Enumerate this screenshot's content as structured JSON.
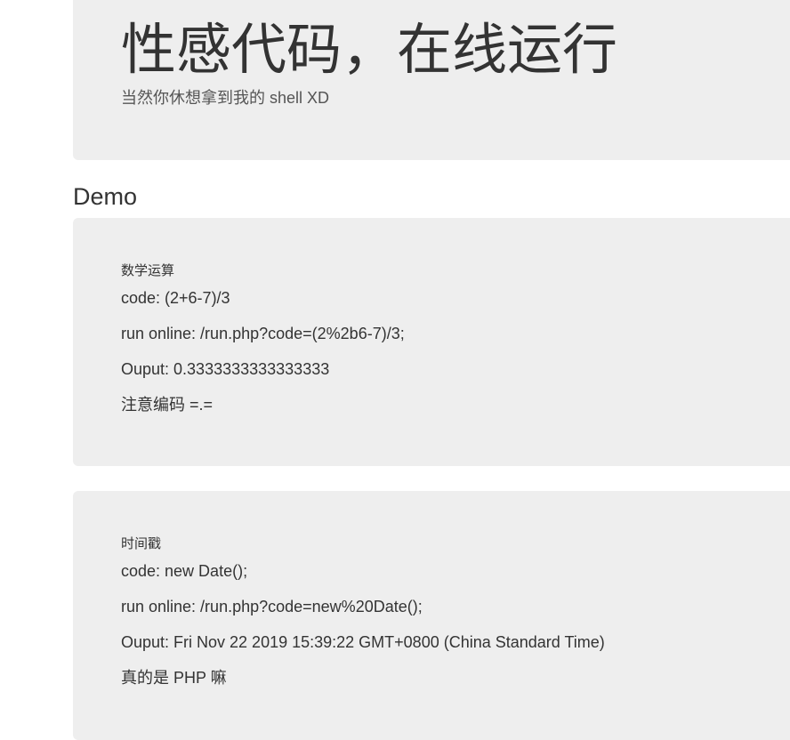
{
  "header": {
    "title": "性感代码，在线运行",
    "subtitle": "当然你休想拿到我的 shell XD"
  },
  "section": {
    "heading": "Demo"
  },
  "demos": [
    {
      "title": "数学运算",
      "code": "code: (2+6-7)/3",
      "run": "run online: /run.php?code=(2%2b6-7)/3;",
      "output": "Ouput: 0.3333333333333333",
      "note": "注意编码 =.="
    },
    {
      "title": "时间戳",
      "code": "code: new Date();",
      "run": "run online: /run.php?code=new%20Date();",
      "output": "Ouput: Fri Nov 22 2019 15:39:22 GMT+0800 (China Standard Time)",
      "note": "真的是 PHP 嘛"
    }
  ]
}
